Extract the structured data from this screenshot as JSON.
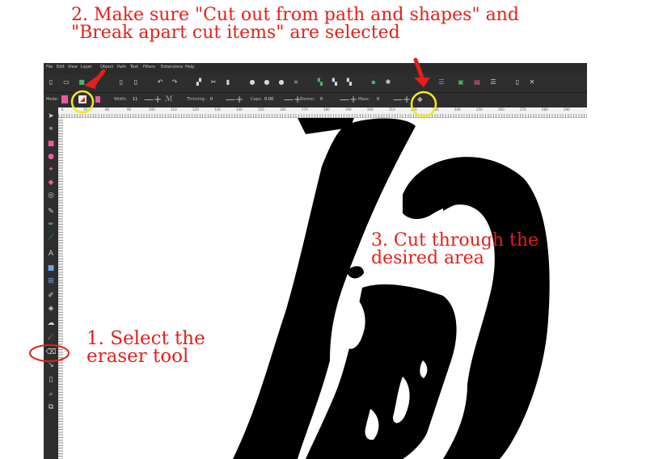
{
  "annotations": {
    "step2_line1": "2. Make sure \"Cut out from path and shapes\" and",
    "step2_line2": "\"Break apart cut items\" are selected",
    "step3_line1": "3. Cut through the",
    "step3_line2": "desired area",
    "step1_line1": "1. Select the",
    "step1_line2": "eraser tool",
    "color": "#e3201b",
    "highlight_color": "#f2ea1d"
  },
  "menubar": {
    "items": [
      "File",
      "Edit",
      "View",
      "Layer",
      "Object",
      "Path",
      "Text",
      "Filters",
      "Extensions",
      "Help"
    ]
  },
  "controls": {
    "mode_label": "Mode:",
    "width_label": "Width:",
    "width_value": "11",
    "thinning_label": "Thinning:",
    "thinning_value": "0",
    "caps_label": "Caps:",
    "caps_value": "0.00",
    "tremor_label": "Tremor:",
    "tremor_value": "0",
    "mass_label": "Mass:",
    "mass_value": "0"
  },
  "ruler": {
    "ticks": [
      "0",
      "70",
      "80",
      "90",
      "100",
      "110",
      "120",
      "130",
      "140",
      "150",
      "160",
      "170",
      "180",
      "190",
      "200",
      "210",
      "220",
      "230",
      "240",
      "250",
      "260",
      "270",
      "280",
      "290"
    ]
  },
  "icons": {
    "command_bar": [
      "new-document-icon",
      "open-icon",
      "save-icon",
      "print-icon",
      "import-icon",
      "export-icon",
      "undo-icon",
      "redo-icon",
      "copy-icon",
      "cut-icon",
      "paste-icon",
      "zoom-selection-icon",
      "zoom-drawing-icon",
      "zoom-page-icon",
      "zoom-width-icon",
      "duplicate-icon",
      "clone-icon",
      "unlink-clone-icon",
      "group-icon",
      "ungroup-icon",
      "fill-stroke-icon",
      "text-font-icon",
      "layers-icon",
      "xml-editor-icon",
      "align-icon",
      "preferences-icon",
      "document-properties-icon"
    ],
    "toolbox": [
      "selector-tool-icon",
      "node-tool-icon",
      "rectangle-tool-icon",
      "circle-tool-icon",
      "star-tool-icon",
      "box-3d-tool-icon",
      "spiral-tool-icon",
      "pencil-tool-icon",
      "pen-tool-icon",
      "calligraphy-tool-icon",
      "text-tool-icon",
      "gradient-tool-icon",
      "mesh-tool-icon",
      "dropper-tool-icon",
      "paint-bucket-tool-icon",
      "tweak-tool-icon",
      "spray-tool-icon",
      "eraser-tool-icon",
      "connector-tool-icon",
      "page-tool-icon",
      "zoom-tool-icon",
      "measure-tool-icon"
    ]
  }
}
